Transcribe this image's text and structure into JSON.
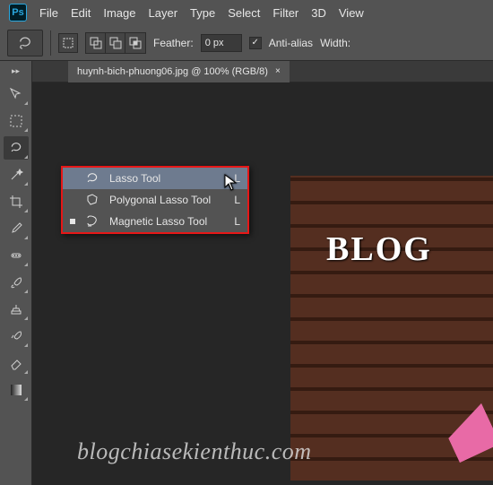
{
  "menubar": {
    "items": [
      "File",
      "Edit",
      "Image",
      "Layer",
      "Type",
      "Select",
      "Filter",
      "3D",
      "View"
    ]
  },
  "optionsbar": {
    "feather_label": "Feather:",
    "feather_value": "0 px",
    "antialias_label": "Anti-alias",
    "antialias_checked": true,
    "width_label": "Width:"
  },
  "tab": {
    "title": "huynh-bich-phuong06.jpg @ 100% (RGB/8)",
    "close": "×"
  },
  "canvas": {
    "blog_text": "BLOG"
  },
  "tools": {
    "items": [
      {
        "name": "move-tool"
      },
      {
        "name": "marquee-tool"
      },
      {
        "name": "lasso-tool",
        "active": true
      },
      {
        "name": "magic-wand-tool"
      },
      {
        "name": "crop-tool"
      },
      {
        "name": "eyedropper-tool"
      },
      {
        "name": "healing-brush-tool"
      },
      {
        "name": "brush-tool"
      },
      {
        "name": "clone-stamp-tool"
      },
      {
        "name": "history-brush-tool"
      },
      {
        "name": "eraser-tool"
      },
      {
        "name": "gradient-tool"
      }
    ]
  },
  "flyout": {
    "items": [
      {
        "label": "Lasso Tool",
        "key": "L",
        "highlight": true,
        "icon": "lasso-icon"
      },
      {
        "label": "Polygonal Lasso Tool",
        "key": "L",
        "icon": "polygonal-lasso-icon"
      },
      {
        "label": "Magnetic Lasso Tool",
        "key": "L",
        "icon": "magnetic-lasso-icon",
        "current": true
      }
    ]
  },
  "watermark": "blogchiasekienthuc.com"
}
